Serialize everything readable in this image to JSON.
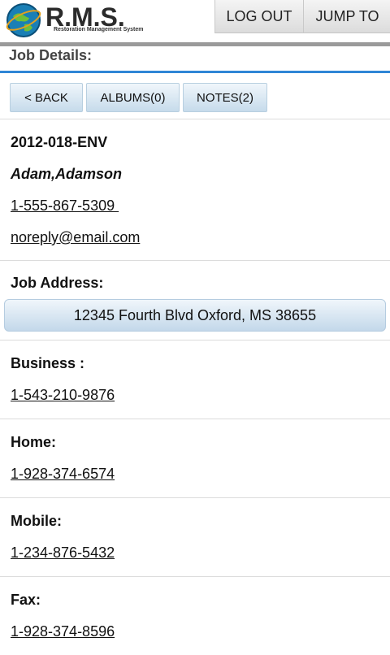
{
  "header": {
    "logo_text": "R.M.S.",
    "logo_subtitle": "Restoration Management System",
    "logout_label": "LOG OUT",
    "jump_label": "JUMP TO"
  },
  "section": {
    "title": "Job Details:"
  },
  "nav": {
    "back_label": "< BACK",
    "albums_label": "ALBUMS(0)",
    "notes_label": "NOTES(2)"
  },
  "job": {
    "number": "2012-018-ENV",
    "customer_name": "Adam,Adamson",
    "phone": "1-555-867-5309 ",
    "email": "noreply@email.com"
  },
  "address": {
    "label": "Job Address:",
    "value": "12345 Fourth Blvd Oxford, MS 38655"
  },
  "contacts": [
    {
      "label": "Business :",
      "number": "1-543-210-9876"
    },
    {
      "label": "Home:",
      "number": "1-928-374-6574"
    },
    {
      "label": "Mobile:",
      "number": "1-234-876-5432"
    },
    {
      "label": "Fax:",
      "number": "1-928-374-8596"
    }
  ],
  "colors": {
    "accent": "#2f86d6",
    "button_top": "#f0f6fb",
    "button_bottom": "#c6dbeb"
  }
}
